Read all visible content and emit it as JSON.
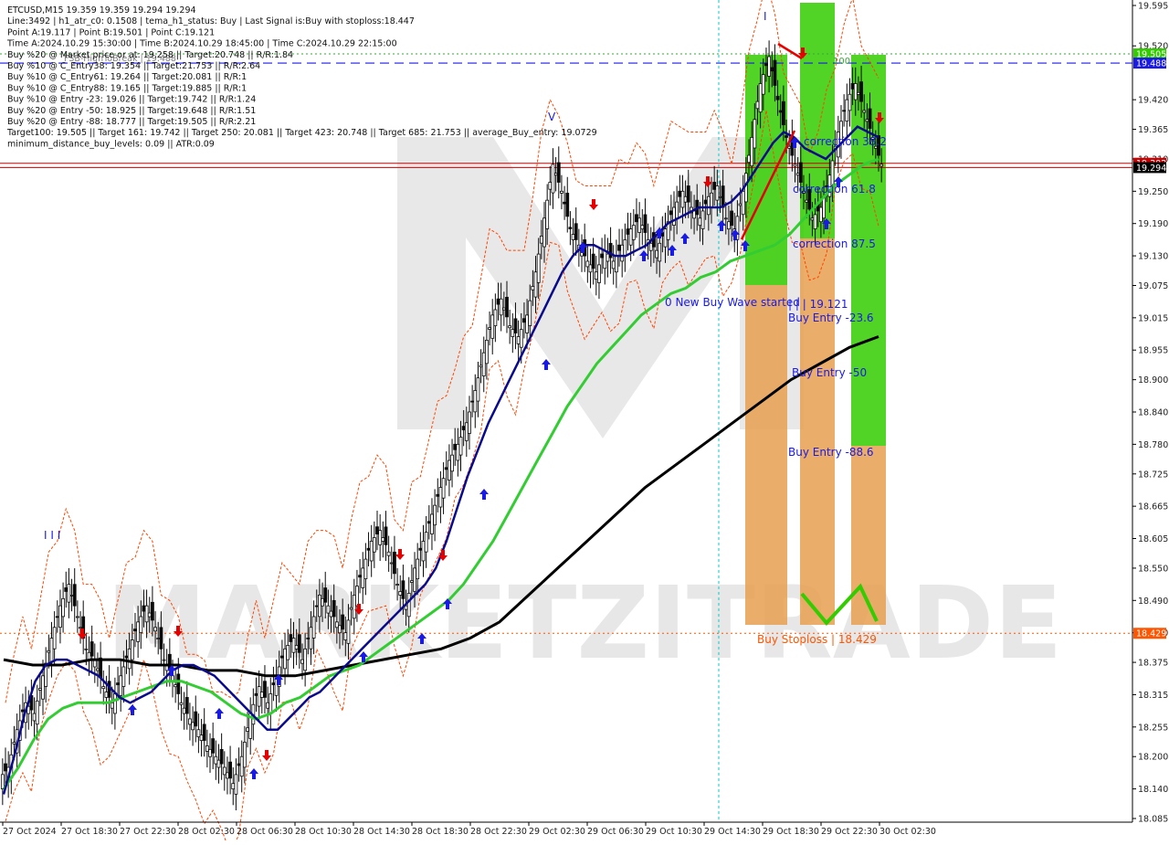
{
  "info": {
    "lines": [
      "ETCUSD,M15  19.359 19.359 19.294 19.294",
      "Line:3492  |  h1_atr_c0: 0.1508  |  tema_h1_status: Buy  |  Last Signal is:Buy with stoploss:18.447",
      "Point A:19.117  |  Point B:19.501  |  Point C:19.121",
      "Time A:2024.10.29 15:30:00  |  Time B:2024.10.29 18:45:00  |  Time C:2024.10.29 22:15:00",
      "Buy %20 @ Market price or at: 19.258  ||  Target:20.748  ||  R/R:1.84",
      "Buy %10 @ C_Entry38: 19.354  ||  Target:21.753  ||  R/R:2.64",
      "Buy %10 @ C_Entry61: 19.264  ||  Target:20.081  ||  R/R:1",
      "Buy %10 @ C_Entry88: 19.165  ||  Target:19.885  ||  R/R:1",
      "Buy %10 @ Entry -23: 19.026  ||  Target:19.742  ||  R/R:1.24",
      "Buy %20 @ Entry -50: 18.925  ||  Target:19.648  ||  R/R:1.51",
      "Buy %20 @ Entry -88: 18.777  ||  Target:19.505  ||  R/R:2.21",
      "Target100: 19.505  ||  Target 161: 19.742  ||  Target 250: 20.081  ||  Target 423: 20.748  ||  Target 685: 21.753  ||  average_Buy_entry: 19.0729",
      "minimum_distance_buy_levels: 0.09  ||  ATR:0.09"
    ],
    "overlap_label": "FSB-HighToBreak | 19.488"
  },
  "watermark": "MARKETZITRADE",
  "annotations": {
    "wave_started": "0 New Buy Wave started",
    "point_c": "| | | 19.121",
    "correction_38": "correction 38.2",
    "correction_61": "correction 61.8",
    "correction_87": "correction 87.5",
    "entry_23": "Buy Entry -23.6",
    "entry_50": "Buy Entry -50",
    "entry_88": "Buy Entry -88.6",
    "stoploss": "Buy Stoploss | 18.429",
    "level_100": "100",
    "wave_marker_i": "I",
    "wave_marker_v": "V",
    "wave_marker_iii": "I I I"
  },
  "colors": {
    "background": "#ffffff",
    "bull_candle": "#0a0a0a",
    "bear_candle": "#0a0a0a",
    "ema_fast": "#0a0a8c",
    "ema_mid": "#33cc33",
    "ema_slow": "#000000",
    "envelope": "#ff4400",
    "buy_arrow": "#1a1ae6",
    "sell_arrow": "#e60000",
    "zone_green": "#33cc00",
    "zone_orange": "#e8a050",
    "target_line": "#1a1ae6",
    "price_line": "#cc0000",
    "stop_line": "#ff5500",
    "time_marker": "#00cccc"
  },
  "chart_data": {
    "type": "candlestick",
    "symbol": "ETCUSD",
    "timeframe": "M15",
    "ohlc_header": {
      "open": 19.359,
      "high": 19.359,
      "low": 19.294,
      "close": 19.294
    },
    "ylim": [
      18.085,
      19.595
    ],
    "y_ticks": [
      "19.595",
      "19.520",
      "19.420",
      "19.365",
      "19.310",
      "19.250",
      "19.190",
      "19.130",
      "19.075",
      "19.015",
      "18.955",
      "18.900",
      "18.840",
      "18.780",
      "18.725",
      "18.665",
      "18.605",
      "18.550",
      "18.490",
      "18.430",
      "18.375",
      "18.315",
      "18.255",
      "18.200",
      "18.140",
      "18.085"
    ],
    "x_ticks": [
      "27 Oct 2024",
      "27 Oct 18:30",
      "27 Oct 22:30",
      "28 Oct 02:30",
      "28 Oct 06:30",
      "28 Oct 10:30",
      "28 Oct 14:30",
      "28 Oct 18:30",
      "28 Oct 22:30",
      "29 Oct 02:30",
      "29 Oct 06:30",
      "29 Oct 10:30",
      "29 Oct 14:30",
      "29 Oct 18:30",
      "29 Oct 22:30",
      "30 Oct 02:30"
    ],
    "price_badges": [
      {
        "label": "19.505",
        "value": 19.505,
        "color": "#33cc00"
      },
      {
        "label": "19.488",
        "value": 19.488,
        "color": "#1a1ae6"
      },
      {
        "label": "19.302",
        "value": 19.302,
        "color": "#cc0000"
      },
      {
        "label": "19.294",
        "value": 19.294,
        "color": "#000000"
      },
      {
        "label": "18.429",
        "value": 18.429,
        "color": "#ff5500"
      }
    ],
    "horizontal_levels": [
      {
        "name": "target-100",
        "value": 19.505,
        "style": "dotted",
        "color": "#33aa33"
      },
      {
        "name": "high-to-break",
        "value": 19.488,
        "style": "dashed",
        "color": "#1a1ae6"
      },
      {
        "name": "current-price",
        "value": 19.302,
        "style": "solid",
        "color": "#cc0000"
      },
      {
        "name": "current-price-2",
        "value": 19.294,
        "style": "solid",
        "color": "#cc0000"
      },
      {
        "name": "stoploss",
        "value": 18.429,
        "style": "dotted",
        "color": "#ff5500"
      }
    ],
    "close_series": [
      18.18,
      18.25,
      18.3,
      18.28,
      18.35,
      18.42,
      18.48,
      18.52,
      18.46,
      18.4,
      18.38,
      18.33,
      18.3,
      18.35,
      18.4,
      18.45,
      18.48,
      18.44,
      18.38,
      18.35,
      18.3,
      18.27,
      18.25,
      18.22,
      18.2,
      18.18,
      18.15,
      18.2,
      18.28,
      18.33,
      18.3,
      18.35,
      18.4,
      18.42,
      18.38,
      18.44,
      18.5,
      18.48,
      18.45,
      18.43,
      18.5,
      18.55,
      18.6,
      18.62,
      18.58,
      18.52,
      18.48,
      18.55,
      18.6,
      18.65,
      18.7,
      18.75,
      18.78,
      18.82,
      18.88,
      18.95,
      19.02,
      19.05,
      19.0,
      18.98,
      19.02,
      19.1,
      19.2,
      19.3,
      19.25,
      19.18,
      19.15,
      19.12,
      19.1,
      19.14,
      19.12,
      19.15,
      19.18,
      19.2,
      19.16,
      19.14,
      19.18,
      19.22,
      19.25,
      19.22,
      19.2,
      19.24,
      19.26,
      19.2,
      19.18,
      19.25,
      19.35,
      19.45,
      19.5,
      19.42,
      19.35,
      19.3,
      19.25,
      19.2,
      19.22,
      19.28,
      19.36,
      19.42,
      19.45,
      19.4,
      19.35,
      19.3
    ],
    "ema_fast_series": [
      18.13,
      18.2,
      18.28,
      18.34,
      18.37,
      18.38,
      18.38,
      18.37,
      18.36,
      18.35,
      18.33,
      18.31,
      18.3,
      18.31,
      18.32,
      18.34,
      18.36,
      18.37,
      18.37,
      18.36,
      18.35,
      18.33,
      18.31,
      18.29,
      18.27,
      18.25,
      18.25,
      18.27,
      18.29,
      18.31,
      18.32,
      18.34,
      18.36,
      18.38,
      18.4,
      18.42,
      18.44,
      18.46,
      18.48,
      18.5,
      18.52,
      18.55,
      18.6,
      18.66,
      18.72,
      18.77,
      18.82,
      18.86,
      18.9,
      18.94,
      18.98,
      19.02,
      19.06,
      19.1,
      19.13,
      19.15,
      19.15,
      19.14,
      19.13,
      19.13,
      19.14,
      19.15,
      19.17,
      19.19,
      19.2,
      19.21,
      19.22,
      19.22,
      19.22,
      19.23,
      19.25,
      19.28,
      19.31,
      19.34,
      19.36,
      19.35,
      19.33,
      19.32,
      19.31,
      19.33,
      19.35,
      19.37,
      19.36,
      19.35
    ],
    "ema_mid_series": [
      18.14,
      18.18,
      18.23,
      18.27,
      18.29,
      18.3,
      18.3,
      18.3,
      18.31,
      18.32,
      18.33,
      18.34,
      18.34,
      18.33,
      18.32,
      18.3,
      18.28,
      18.27,
      18.28,
      18.3,
      18.31,
      18.33,
      18.35,
      18.36,
      18.37,
      18.39,
      18.41,
      18.43,
      18.45,
      18.47,
      18.49,
      18.52,
      18.56,
      18.6,
      18.65,
      18.7,
      18.75,
      18.8,
      18.85,
      18.89,
      18.93,
      18.96,
      18.99,
      19.02,
      19.04,
      19.06,
      19.07,
      19.09,
      19.1,
      19.12,
      19.13,
      19.14,
      19.15,
      19.17,
      19.2,
      19.23,
      19.26,
      19.28,
      19.3,
      19.31
    ],
    "ema_slow_series": [
      18.38,
      18.37,
      18.37,
      18.38,
      18.38,
      18.37,
      18.37,
      18.36,
      18.36,
      18.35,
      18.35,
      18.36,
      18.37,
      18.38,
      18.39,
      18.4,
      18.42,
      18.45,
      18.5,
      18.55,
      18.6,
      18.65,
      18.7,
      18.74,
      18.78,
      18.82,
      18.86,
      18.9,
      18.93,
      18.96,
      18.98
    ]
  }
}
